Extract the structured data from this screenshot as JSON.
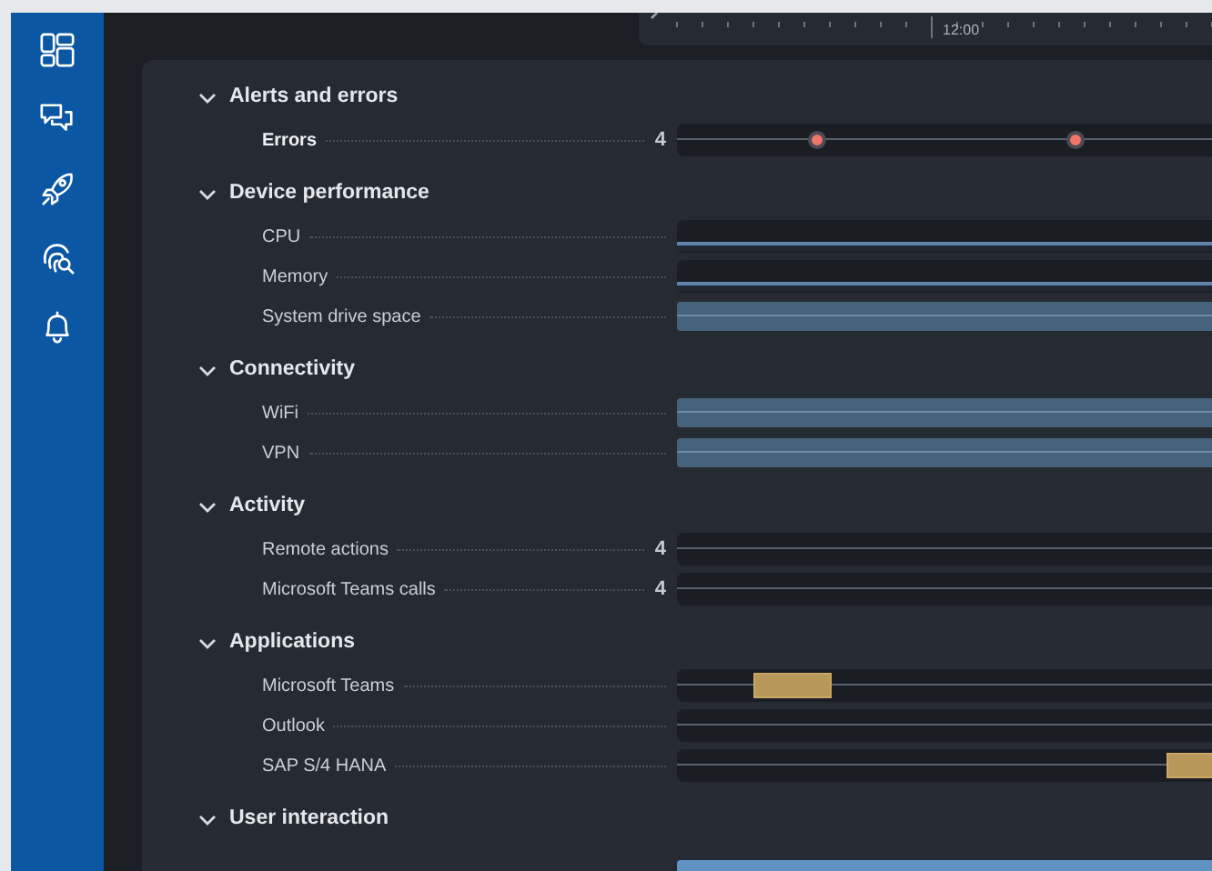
{
  "sidebar": {
    "items": [
      {
        "kind": "dashboard"
      },
      {
        "kind": "chat"
      },
      {
        "kind": "rocket"
      },
      {
        "kind": "fingerprint"
      },
      {
        "kind": "bell"
      }
    ]
  },
  "timeline": {
    "tick_label": "12:00"
  },
  "sections": [
    {
      "title": "Alerts and errors",
      "expanded": true,
      "rows": [
        {
          "label": "Errors",
          "emphasis": true,
          "count": "4",
          "kind": "events"
        }
      ]
    },
    {
      "title": "Device performance",
      "expanded": true,
      "rows": [
        {
          "label": "CPU",
          "kind": "usage_line"
        },
        {
          "label": "Memory",
          "kind": "usage_line"
        },
        {
          "label": "System drive space",
          "kind": "band"
        }
      ]
    },
    {
      "title": "Connectivity",
      "expanded": true,
      "rows": [
        {
          "label": "WiFi",
          "kind": "band"
        },
        {
          "label": "VPN",
          "kind": "band"
        }
      ]
    },
    {
      "title": "Activity",
      "expanded": true,
      "rows": [
        {
          "label": "Remote actions",
          "count": "4",
          "kind": "count_line"
        },
        {
          "label": "Microsoft Teams calls",
          "count": "4",
          "kind": "count_line"
        }
      ]
    },
    {
      "title": "Applications",
      "expanded": true,
      "rows": [
        {
          "label": "Microsoft Teams",
          "kind": "app_usage"
        },
        {
          "label": "Outlook",
          "kind": "app_usage"
        },
        {
          "label": "SAP S/4 HANA",
          "kind": "app_usage"
        }
      ]
    },
    {
      "title": "User interaction",
      "expanded": true,
      "rows": [
        {
          "kind": "highlight_band"
        }
      ]
    }
  ]
}
